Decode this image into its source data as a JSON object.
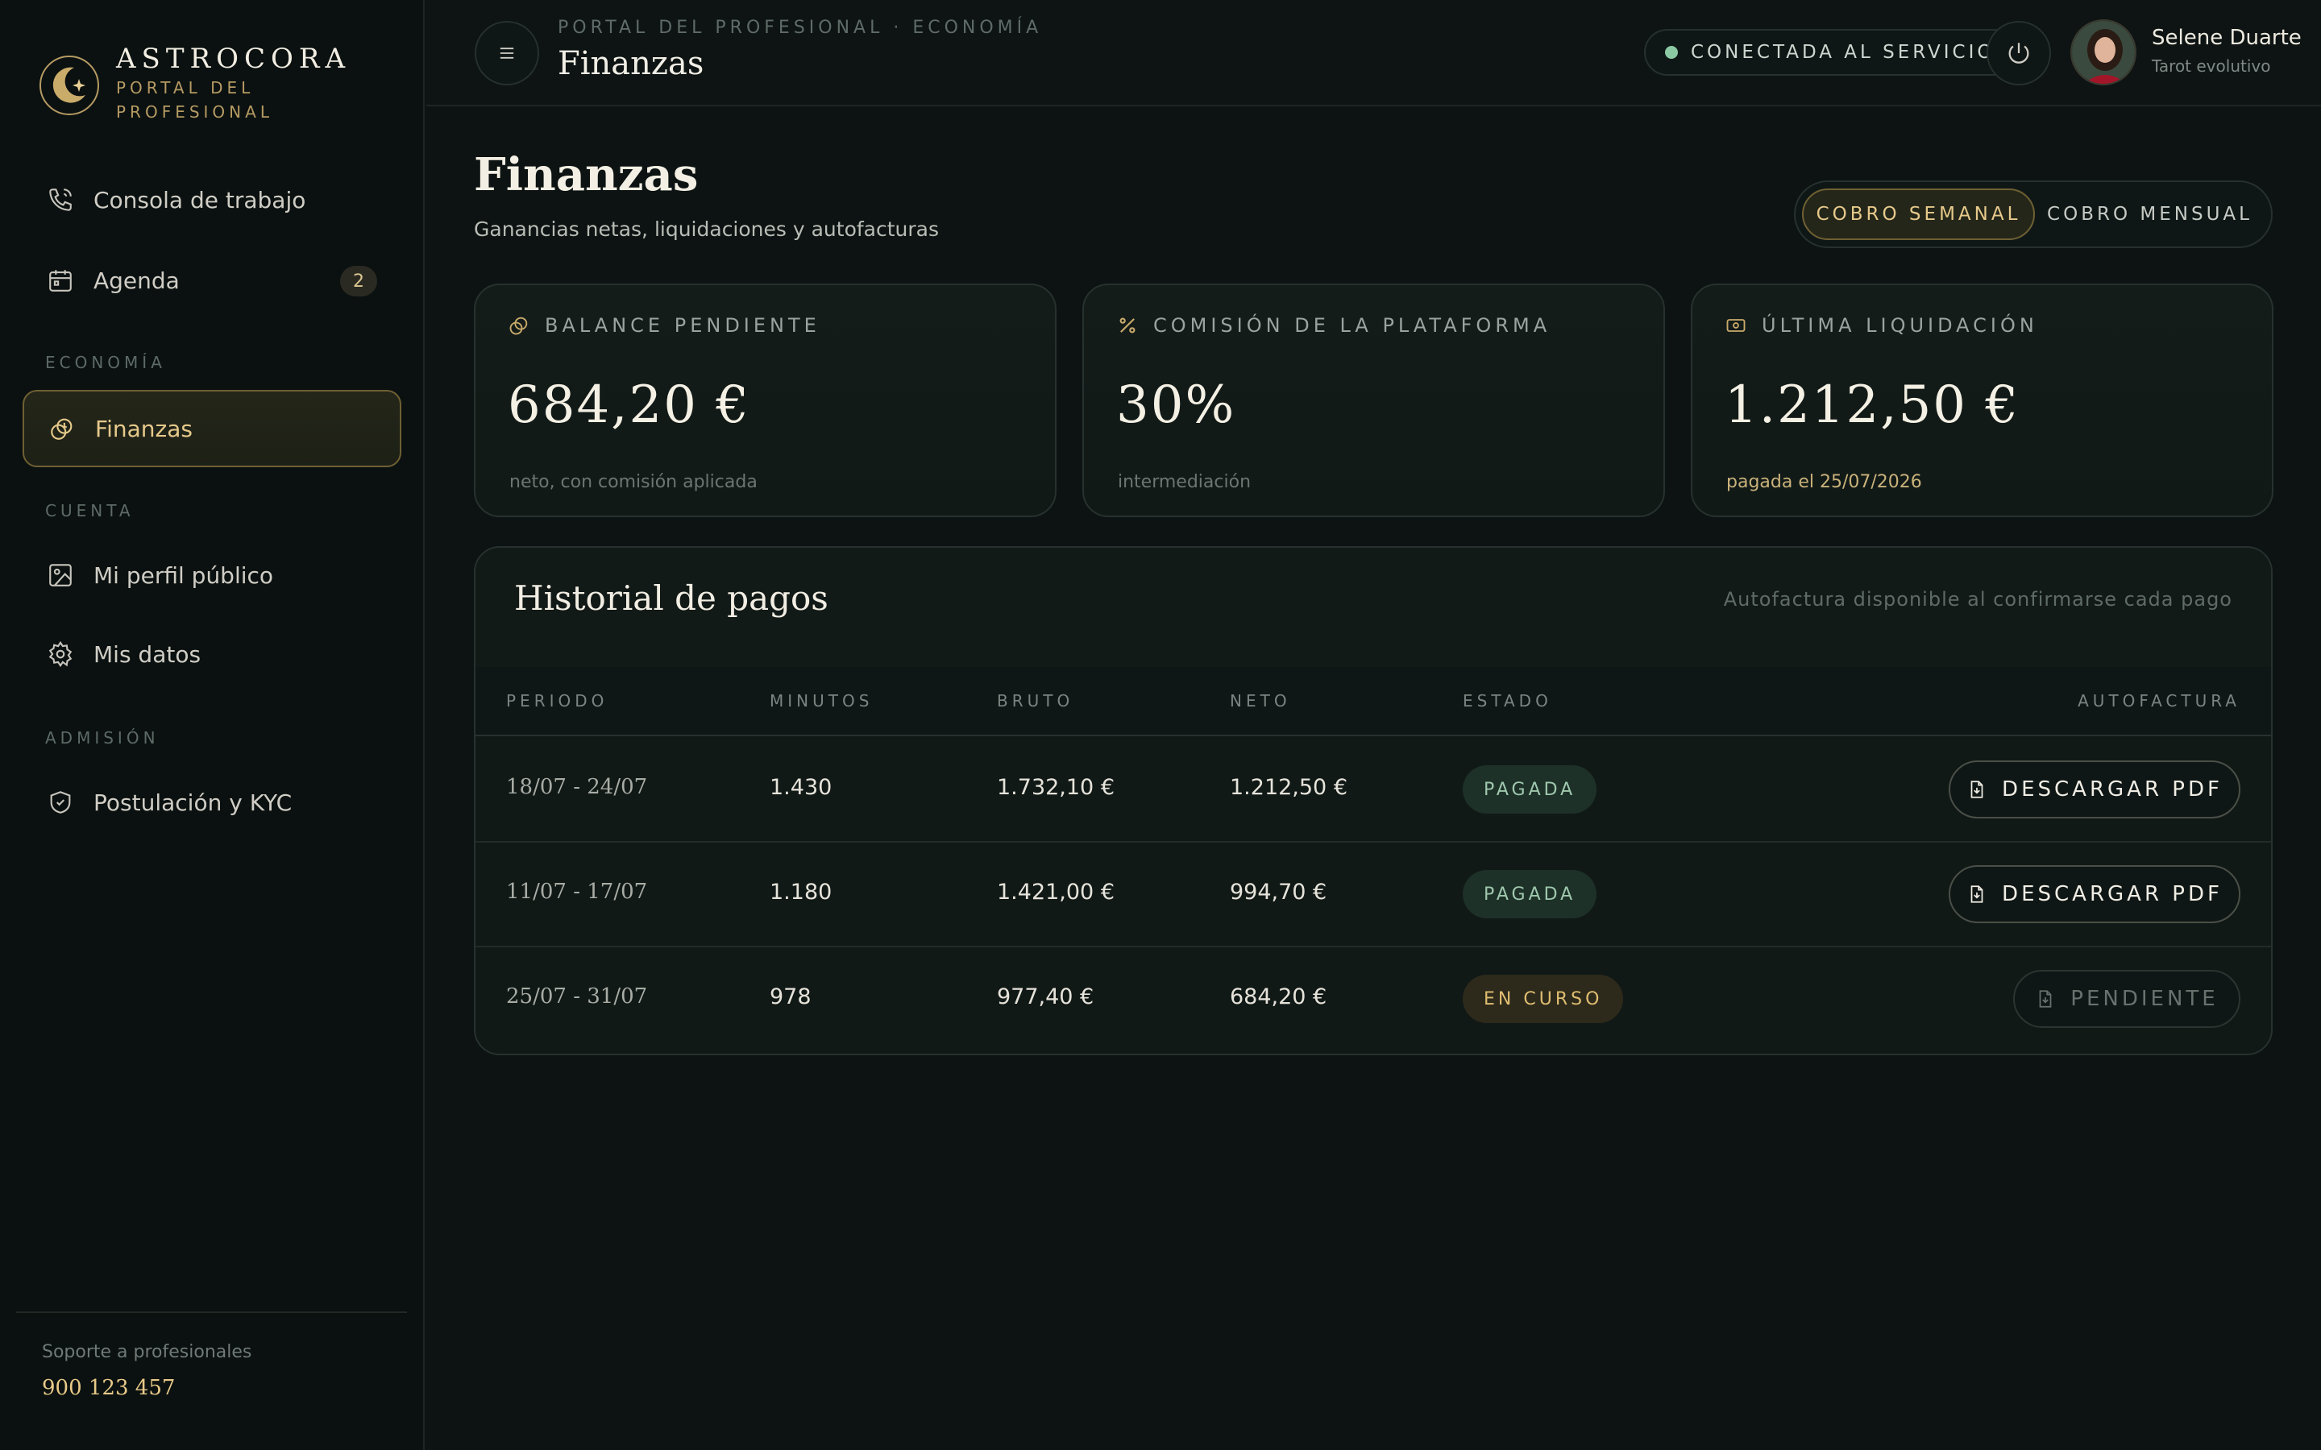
{
  "brand": {
    "name": "ASTROCORA",
    "subtitle": "PORTAL DEL PROFESIONAL"
  },
  "sidebar": {
    "items": [
      {
        "label": "Consola de trabajo",
        "icon": "phone-icon"
      },
      {
        "label": "Agenda",
        "icon": "calendar-icon",
        "badge": "2"
      },
      {
        "label": "Finanzas",
        "icon": "coins-icon",
        "active": true
      },
      {
        "label": "Mi perfil público",
        "icon": "image-icon"
      },
      {
        "label": "Mis datos",
        "icon": "gear-icon"
      },
      {
        "label": "Postulación y KYC",
        "icon": "shield-icon"
      }
    ],
    "sections": [
      "ECONOMÍA",
      "CUENTA",
      "ADMISIÓN"
    ],
    "support_label": "Soporte a profesionales",
    "support_phone": "900 123 457"
  },
  "header": {
    "breadcrumb": "PORTAL DEL PROFESIONAL · ECONOMÍA",
    "title": "Finanzas",
    "status": "CONECTADA AL SERVICIO",
    "user_name": "Selene Duarte",
    "user_role": "Tarot evolutivo"
  },
  "page": {
    "title": "Finanzas",
    "subtitle": "Ganancias netas, liquidaciones y autofacturas",
    "toggle": {
      "weekly": "COBRO SEMANAL",
      "monthly": "COBRO MENSUAL"
    }
  },
  "cards": [
    {
      "label": "BALANCE PENDIENTE",
      "value": "684,20 €",
      "foot": "neto, con comisión aplicada",
      "icon": "coins-icon"
    },
    {
      "label": "COMISIÓN DE LA PLATAFORMA",
      "value": "30%",
      "foot": "intermediación",
      "icon": "percent-icon"
    },
    {
      "label": "ÚLTIMA LIQUIDACIÓN",
      "value": "1.212,50 €",
      "foot": "pagada el 25/07/2026",
      "icon": "banknote-icon"
    }
  ],
  "history": {
    "title": "Historial de pagos",
    "note": "Autofactura disponible al confirmarse cada pago",
    "columns": [
      "PERIODO",
      "MINUTOS",
      "BRUTO",
      "NETO",
      "ESTADO",
      "AUTOFACTURA"
    ],
    "rows": [
      {
        "period": "18/07 - 24/07",
        "minutes": "1.430",
        "gross": "1.732,10 €",
        "net": "1.212,50 €",
        "status": "PAGADA",
        "action": "DESCARGAR PDF"
      },
      {
        "period": "11/07 - 17/07",
        "minutes": "1.180",
        "gross": "1.421,00 €",
        "net": "994,70 €",
        "status": "PAGADA",
        "action": "DESCARGAR PDF"
      },
      {
        "period": "25/07 - 31/07",
        "minutes": "978",
        "gross": "977,40 €",
        "net": "684,20 €",
        "status": "EN CURSO",
        "action": "PENDIENTE"
      }
    ]
  },
  "colors": {
    "accent": "#e6c98b",
    "background": "#0c1312",
    "paid": "#9fc8ae",
    "current": "#e0bd72",
    "status_dot": "#8bc9a3"
  }
}
